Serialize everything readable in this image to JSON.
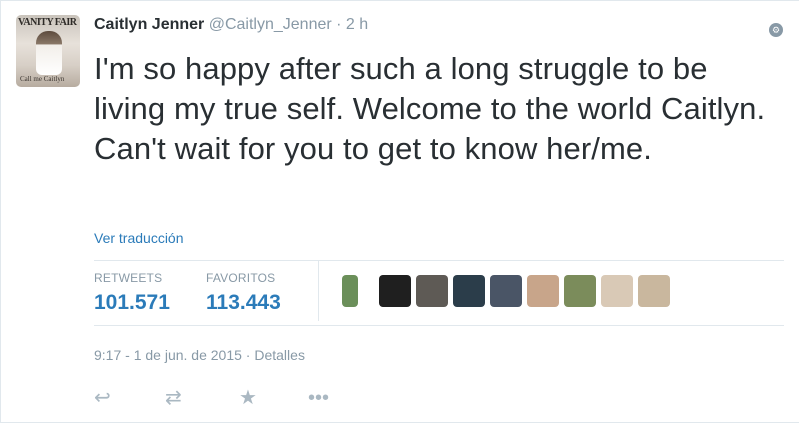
{
  "tweet": {
    "author_name": "Caitlyn Jenner",
    "handle": "@Caitlyn_Jenner",
    "separator": "·",
    "time_ago": "2 h",
    "text": "I'm so happy after such a long struggle to be living my true self. Welcome to the world Caitlyn. Can't wait for you to get to know her/me.",
    "translate_link": "Ver traducción",
    "avatar": {
      "masthead": "VANITY FAIR",
      "caption": "Call me Caitlyn"
    },
    "stats": {
      "retweets_label": "RETWEETS",
      "retweets_value": "101.571",
      "favorites_label": "FAVORITOS",
      "favorites_value": "113.443"
    },
    "favoriters": [
      {
        "color": "#6b8f5a"
      },
      {
        "color": "#1f1f1f"
      },
      {
        "color": "#5e5a55"
      },
      {
        "color": "#2b3d4a"
      },
      {
        "color": "#4a5566"
      },
      {
        "color": "#c8a58a"
      },
      {
        "color": "#7b8c5b"
      },
      {
        "color": "#d9c9b6"
      },
      {
        "color": "#c9b79e"
      }
    ],
    "timestamp": "9:17 - 1 de jun. de 2015",
    "details_link": "Detalles",
    "icons": {
      "more": "gear-icon",
      "reply": "reply-icon",
      "retweet": "retweet-icon",
      "favorite": "star-icon",
      "more_actions": "ellipsis-icon"
    }
  }
}
